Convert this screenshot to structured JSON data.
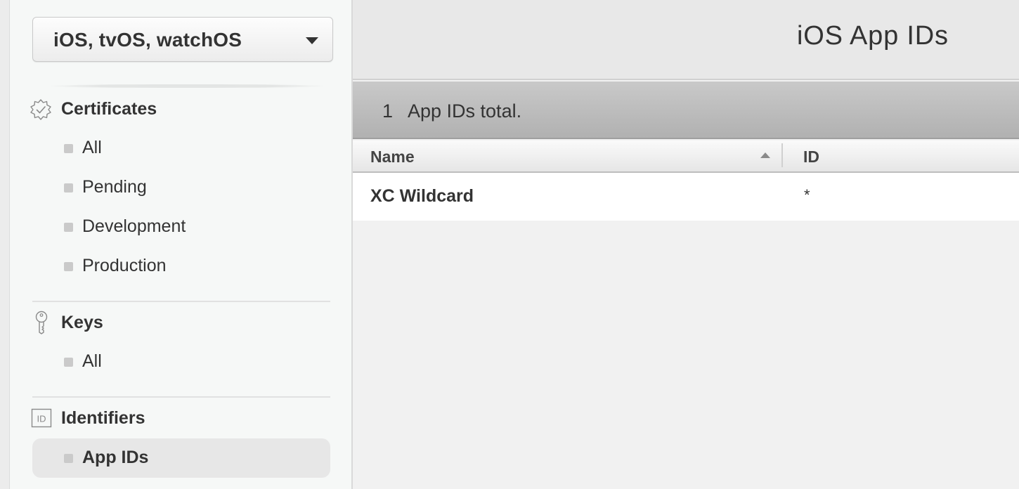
{
  "platform_select": {
    "value": "iOS, tvOS, watchOS"
  },
  "sidebar": {
    "certificates": {
      "title": "Certificates",
      "icon": "certificate-badge-icon",
      "items": [
        {
          "label": "All"
        },
        {
          "label": "Pending"
        },
        {
          "label": "Development"
        },
        {
          "label": "Production"
        }
      ]
    },
    "keys": {
      "title": "Keys",
      "icon": "key-icon",
      "items": [
        {
          "label": "All"
        }
      ]
    },
    "identifiers": {
      "title": "Identifiers",
      "icon": "id-icon",
      "items": [
        {
          "label": "App IDs",
          "selected": true
        }
      ]
    }
  },
  "main": {
    "title": "iOS App IDs",
    "count": "1",
    "count_label": "App IDs total.",
    "table": {
      "columns": [
        "Name",
        "ID"
      ],
      "sort_column": "Name",
      "sort_direction": "ascending",
      "rows": [
        {
          "name": "XC Wildcard",
          "id": "*"
        }
      ]
    }
  }
}
